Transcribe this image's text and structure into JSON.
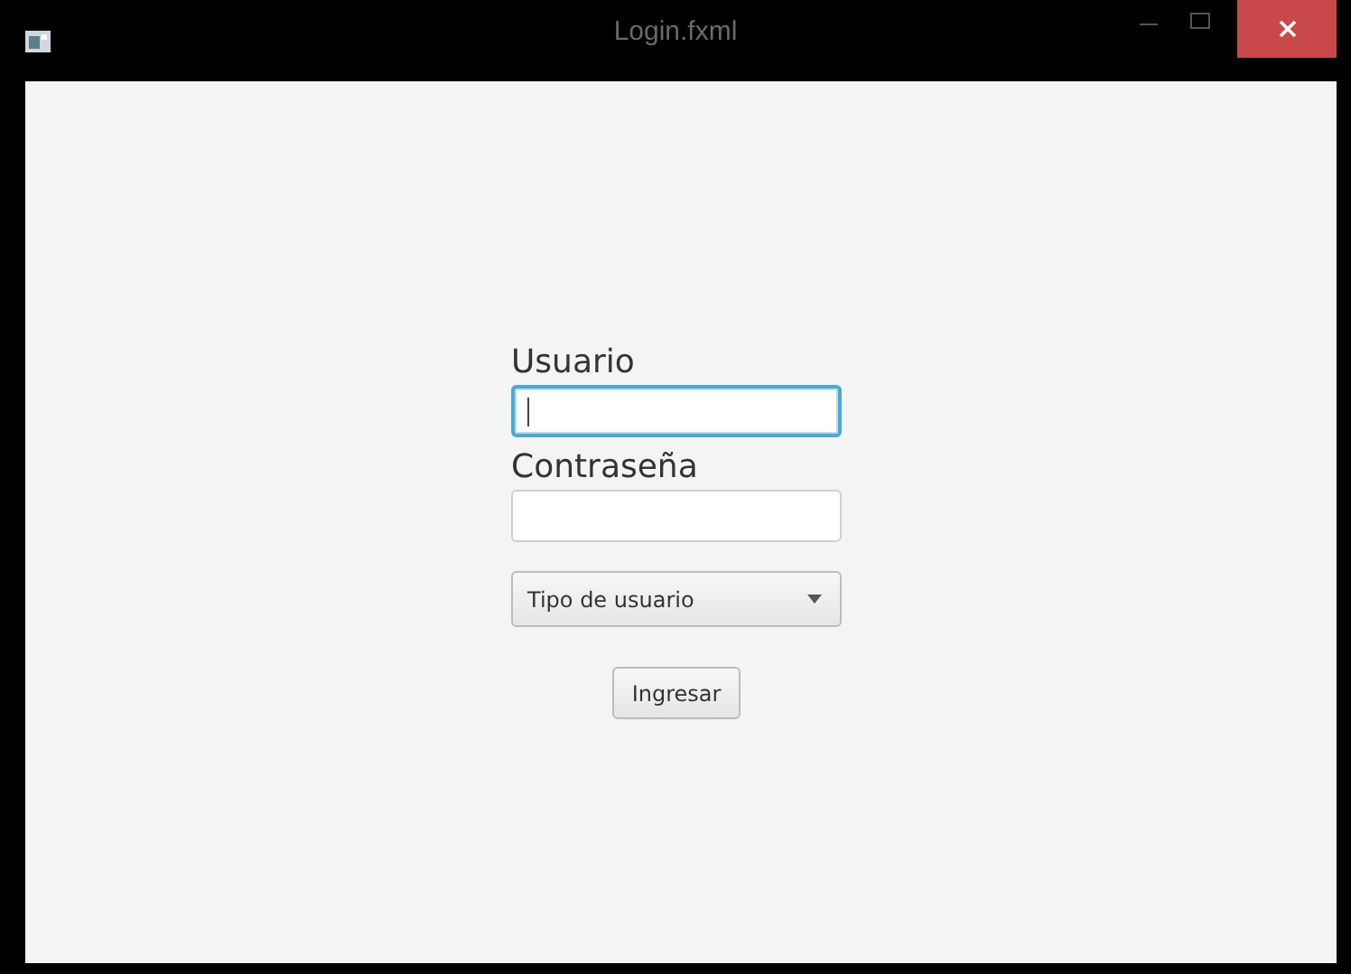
{
  "window": {
    "title": "Login.fxml"
  },
  "fields": [
    {
      "label": "Usuario",
      "focused": true
    },
    {
      "label": "Contraseña",
      "focused": false
    }
  ],
  "user_type": {
    "placeholder": "Tipo de usuario"
  },
  "buttons": [
    "Ingresar"
  ]
}
